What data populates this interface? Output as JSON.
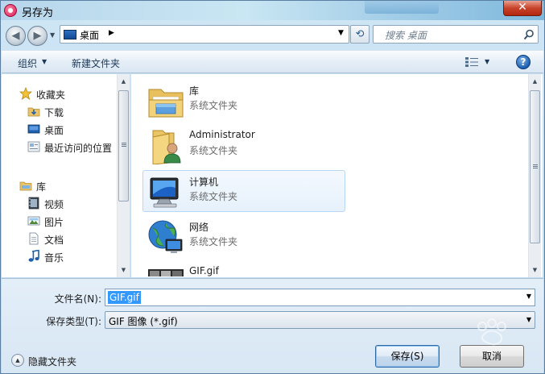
{
  "window": {
    "title": "另存为",
    "close_label": "✕"
  },
  "nav": {
    "back_glyph": "◀",
    "forward_glyph": "▶",
    "address": "桌面",
    "refresh_glyph": "⟲",
    "search_placeholder": "搜索 桌面"
  },
  "toolbar": {
    "organize": "组织",
    "new_folder": "新建文件夹",
    "help": "?"
  },
  "sidebar": {
    "favorites": {
      "label": "收藏夹",
      "icon": "star-icon"
    },
    "favorite_items": [
      {
        "label": "下载",
        "icon": "download-folder-icon"
      },
      {
        "label": "桌面",
        "icon": "desktop-icon"
      },
      {
        "label": "最近访问的位置",
        "icon": "recent-places-icon"
      }
    ],
    "libraries": {
      "label": "库",
      "icon": "library-icon"
    },
    "library_items": [
      {
        "label": "视频",
        "icon": "video-icon"
      },
      {
        "label": "图片",
        "icon": "pictures-icon"
      },
      {
        "label": "文档",
        "icon": "documents-icon"
      },
      {
        "label": "音乐",
        "icon": "music-icon"
      }
    ]
  },
  "files": [
    {
      "name": "库",
      "type": "系统文件夹",
      "icon": "library-folder-icon"
    },
    {
      "name": "Administrator",
      "type": "系统文件夹",
      "icon": "user-folder-icon"
    },
    {
      "name": "计算机",
      "type": "系统文件夹",
      "icon": "computer-icon"
    },
    {
      "name": "网络",
      "type": "系统文件夹",
      "icon": "network-icon"
    },
    {
      "name": "GIF.gif",
      "type": "",
      "icon": "gif-thumbnail-icon"
    }
  ],
  "form": {
    "filename_label": "文件名(N):",
    "filename_value": "GIF.gif",
    "filetype_label": "保存类型(T):",
    "filetype_value": "GIF 图像 (*.gif)",
    "hide_folders": "隐藏文件夹",
    "save": "保存(S)",
    "cancel": "取消"
  },
  "colors": {
    "accent": "#3399ff",
    "selection_border": "#b9d7f3",
    "close": "#c8432b"
  }
}
